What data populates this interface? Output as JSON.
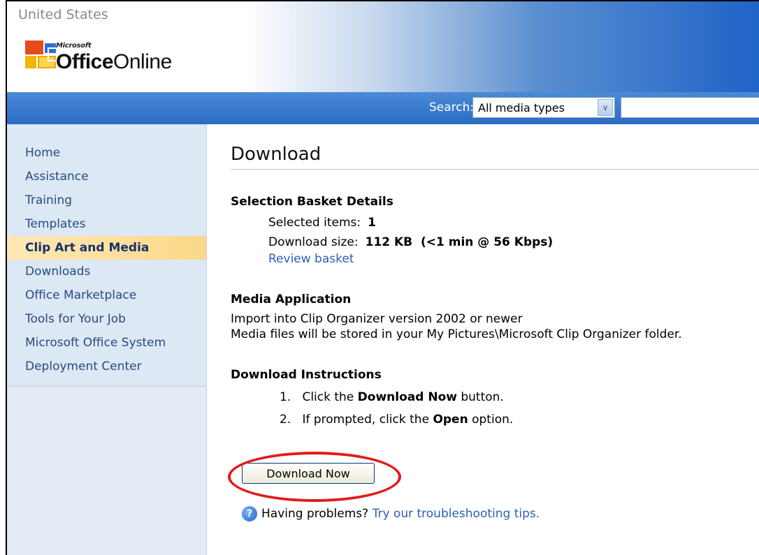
{
  "header": {
    "region": "United States",
    "brand_small": "Microsoft",
    "brand_main": "Office",
    "brand_sub": "Online"
  },
  "search": {
    "label": "Search:",
    "select_value": "All media types",
    "input_value": ""
  },
  "sidebar": {
    "items": [
      {
        "label": "Home"
      },
      {
        "label": "Assistance"
      },
      {
        "label": "Training"
      },
      {
        "label": "Templates"
      },
      {
        "label": "Clip Art and Media",
        "active": true
      },
      {
        "label": "Downloads"
      },
      {
        "label": "Office Marketplace"
      },
      {
        "label": "Tools for Your Job"
      },
      {
        "label": "Microsoft Office System"
      },
      {
        "label": "Deployment Center"
      }
    ]
  },
  "main": {
    "title": "Download",
    "basket": {
      "heading": "Selection Basket Details",
      "selected_label": "Selected items:",
      "selected_value": "1",
      "size_label": "Download size:",
      "size_value": "112 KB  (<1 min @ 56 Kbps)",
      "review_link": "Review basket"
    },
    "media": {
      "heading": "Media Application",
      "line1": "Import into Clip Organizer version 2002 or newer",
      "line2": "Media files will be stored in your My Pictures\\Microsoft Clip Organizer folder."
    },
    "instructions": {
      "heading": "Download Instructions",
      "step1_num": "1.",
      "step1_pre": "Click the ",
      "step1_bold": "Download Now",
      "step1_post": " button.",
      "step2_num": "2.",
      "step2_pre": "If prompted, click the ",
      "step2_bold": "Open",
      "step2_post": " option."
    },
    "download_button": "Download Now",
    "help_text": "Having problems? ",
    "help_link": "Try our troubleshooting tips."
  },
  "colors": {
    "header_blue": "#1f63c7",
    "nav_active": "#fbd889",
    "highlight_ring": "#e21b1b",
    "link": "#2b5fb2"
  },
  "icons": [
    "office-logo-icon",
    "chevron-down-icon",
    "help-icon"
  ]
}
